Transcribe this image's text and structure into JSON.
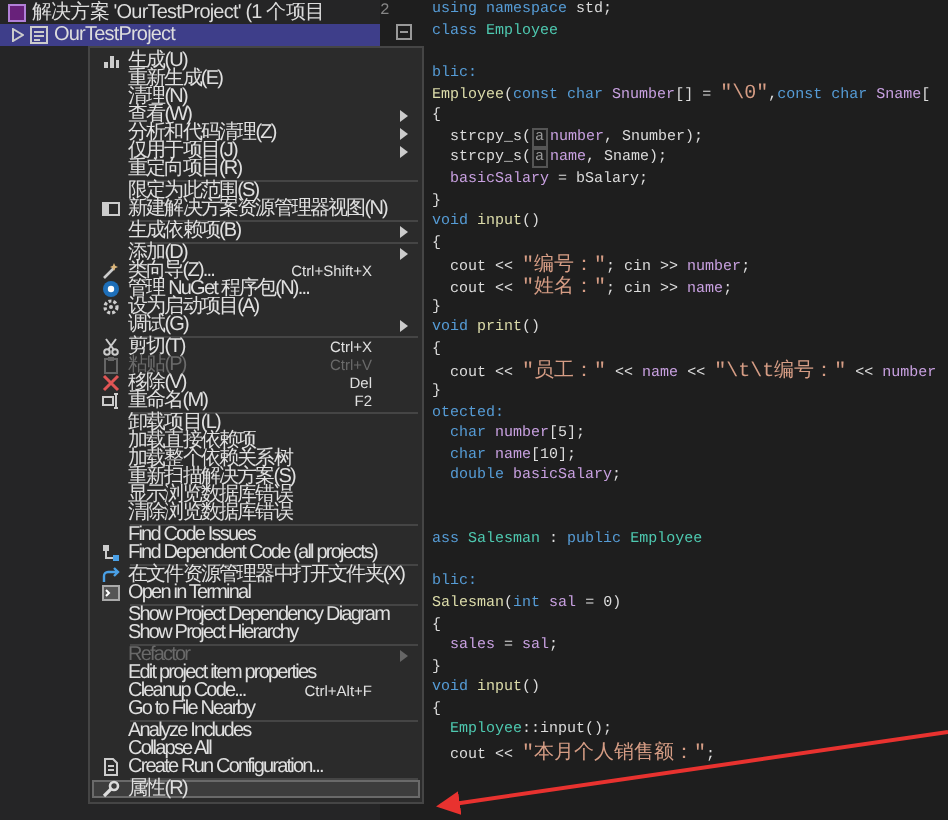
{
  "explorer": {
    "rows": [
      {
        "kind": "solution",
        "label": "解决方案 'OurTestProject' (1 个项目",
        "selected": false
      },
      {
        "kind": "project",
        "label": "OurTestProject",
        "selected": true
      }
    ]
  },
  "editor": {
    "line_numbers": [
      "2"
    ],
    "lines": [
      {
        "kind": "code",
        "tokens": [
          {
            "text": "using namespace ",
            "kind": "kw"
          },
          {
            "text": "std;",
            "kind": "txt"
          }
        ]
      },
      {
        "kind": "code",
        "tokens": [
          {
            "text": "class ",
            "kind": "kw"
          },
          {
            "text": "Employee",
            "kind": "type"
          }
        ]
      },
      {
        "kind": "blank"
      },
      {
        "kind": "code",
        "tokens": [
          {
            "text": "blic:",
            "kind": "kw"
          }
        ]
      },
      {
        "kind": "code",
        "tokens": [
          {
            "text": "Employee",
            "kind": "fn"
          },
          {
            "text": "(",
            "kind": "txt"
          },
          {
            "text": "const char ",
            "kind": "kw"
          },
          {
            "text": "Snumber",
            "kind": "var"
          },
          {
            "text": "[] = ",
            "kind": "txt"
          },
          {
            "text": "\"\\0\"",
            "kind": "str"
          },
          {
            "text": ",",
            "kind": "txt"
          },
          {
            "text": "const char ",
            "kind": "kw"
          },
          {
            "text": "Sname",
            "kind": "var"
          },
          {
            "text": "[",
            "kind": "txt"
          }
        ]
      },
      {
        "kind": "code",
        "tokens": [
          {
            "text": "{",
            "kind": "txt"
          }
        ]
      },
      {
        "kind": "code",
        "tokens": [
          {
            "text": "  strcpy_s(",
            "kind": "txt"
          },
          {
            "text": "a",
            "kind": "hint"
          },
          {
            "text": "number",
            "kind": "var"
          },
          {
            "text": ", Snumber);",
            "kind": "txt"
          }
        ]
      },
      {
        "kind": "code",
        "tokens": [
          {
            "text": "  strcpy_s(",
            "kind": "txt"
          },
          {
            "text": "a",
            "kind": "hint"
          },
          {
            "text": "name",
            "kind": "var"
          },
          {
            "text": ", Sname);",
            "kind": "txt"
          }
        ]
      },
      {
        "kind": "code",
        "tokens": [
          {
            "text": "  basicSalary",
            "kind": "var"
          },
          {
            "text": " = bSalary;",
            "kind": "txt"
          }
        ]
      },
      {
        "kind": "code",
        "tokens": [
          {
            "text": "}",
            "kind": "txt"
          }
        ]
      },
      {
        "kind": "code",
        "tokens": [
          {
            "text": "void ",
            "kind": "kw"
          },
          {
            "text": "input",
            "kind": "fn"
          },
          {
            "text": "()",
            "kind": "txt"
          }
        ]
      },
      {
        "kind": "code",
        "tokens": [
          {
            "text": "{",
            "kind": "txt"
          }
        ]
      },
      {
        "kind": "code",
        "tokens": [
          {
            "text": "  cout << ",
            "kind": "txt"
          },
          {
            "text": "\"编号：\"",
            "kind": "str"
          },
          {
            "text": "; cin >> ",
            "kind": "txt"
          },
          {
            "text": "number",
            "kind": "var"
          },
          {
            "text": ";",
            "kind": "txt"
          }
        ]
      },
      {
        "kind": "code",
        "tokens": [
          {
            "text": "  cout << ",
            "kind": "txt"
          },
          {
            "text": "\"姓名：\"",
            "kind": "str"
          },
          {
            "text": "; cin >> ",
            "kind": "txt"
          },
          {
            "text": "name",
            "kind": "var"
          },
          {
            "text": ";",
            "kind": "txt"
          }
        ]
      },
      {
        "kind": "code",
        "tokens": [
          {
            "text": "}",
            "kind": "txt"
          }
        ]
      },
      {
        "kind": "code",
        "tokens": [
          {
            "text": "void ",
            "kind": "kw"
          },
          {
            "text": "print",
            "kind": "fn"
          },
          {
            "text": "()",
            "kind": "txt"
          }
        ]
      },
      {
        "kind": "code",
        "tokens": [
          {
            "text": "{",
            "kind": "txt"
          }
        ]
      },
      {
        "kind": "code",
        "tokens": [
          {
            "text": "  cout << ",
            "kind": "txt"
          },
          {
            "text": "\"员工：\"",
            "kind": "str"
          },
          {
            "text": " << ",
            "kind": "txt"
          },
          {
            "text": "name",
            "kind": "var"
          },
          {
            "text": " << ",
            "kind": "txt"
          },
          {
            "text": "\"\\t\\t编号：\"",
            "kind": "str"
          },
          {
            "text": " << ",
            "kind": "txt"
          },
          {
            "text": "number",
            "kind": "var"
          }
        ]
      },
      {
        "kind": "code",
        "tokens": [
          {
            "text": "}",
            "kind": "txt"
          }
        ]
      },
      {
        "kind": "code",
        "tokens": [
          {
            "text": "otected:",
            "kind": "kw"
          }
        ]
      },
      {
        "kind": "code",
        "tokens": [
          {
            "text": "  char ",
            "kind": "kw"
          },
          {
            "text": "number",
            "kind": "var"
          },
          {
            "text": "[5];",
            "kind": "txt"
          }
        ]
      },
      {
        "kind": "code",
        "tokens": [
          {
            "text": "  char ",
            "kind": "kw"
          },
          {
            "text": "name",
            "kind": "var"
          },
          {
            "text": "[10];",
            "kind": "txt"
          }
        ]
      },
      {
        "kind": "code",
        "tokens": [
          {
            "text": "  double ",
            "kind": "kw"
          },
          {
            "text": "basicSalary",
            "kind": "var"
          },
          {
            "text": ";",
            "kind": "txt"
          }
        ]
      },
      {
        "kind": "blank"
      },
      {
        "kind": "blank"
      },
      {
        "kind": "code",
        "tokens": [
          {
            "text": "ass ",
            "kind": "kw"
          },
          {
            "text": "Salesman",
            "kind": "type"
          },
          {
            "text": " : ",
            "kind": "txt"
          },
          {
            "text": "public ",
            "kind": "kw"
          },
          {
            "text": "Employee",
            "kind": "type"
          }
        ]
      },
      {
        "kind": "blank"
      },
      {
        "kind": "code",
        "tokens": [
          {
            "text": "blic:",
            "kind": "kw"
          }
        ]
      },
      {
        "kind": "code",
        "tokens": [
          {
            "text": "Salesman",
            "kind": "fn"
          },
          {
            "text": "(",
            "kind": "txt"
          },
          {
            "text": "int ",
            "kind": "kw"
          },
          {
            "text": "sal",
            "kind": "var"
          },
          {
            "text": " = 0)",
            "kind": "txt"
          }
        ]
      },
      {
        "kind": "code",
        "tokens": [
          {
            "text": "{",
            "kind": "txt"
          }
        ]
      },
      {
        "kind": "code",
        "tokens": [
          {
            "text": "  sales",
            "kind": "var"
          },
          {
            "text": " = ",
            "kind": "txt"
          },
          {
            "text": "sal",
            "kind": "var"
          },
          {
            "text": ";",
            "kind": "txt"
          }
        ]
      },
      {
        "kind": "code",
        "tokens": [
          {
            "text": "}",
            "kind": "txt"
          }
        ]
      },
      {
        "kind": "code",
        "tokens": [
          {
            "text": "void ",
            "kind": "kw"
          },
          {
            "text": "input",
            "kind": "fn"
          },
          {
            "text": "()",
            "kind": "txt"
          }
        ]
      },
      {
        "kind": "code",
        "tokens": [
          {
            "text": "{",
            "kind": "txt"
          }
        ]
      },
      {
        "kind": "code",
        "tokens": [
          {
            "text": "  Employee",
            "kind": "type"
          },
          {
            "text": "::input();",
            "kind": "txt"
          }
        ]
      },
      {
        "kind": "code",
        "tokens": [
          {
            "text": "  cout << ",
            "kind": "txt"
          },
          {
            "text": "\"本月个人销售额：\"",
            "kind": "str"
          },
          {
            "text": ";",
            "kind": "txt"
          }
        ]
      }
    ]
  },
  "context_menu": {
    "groups": [
      [
        {
          "label": "生成(U)",
          "sub": false,
          "disabled": false,
          "selected": false
        },
        {
          "label": "重新生成(E)",
          "sub": false,
          "disabled": false,
          "selected": false
        },
        {
          "label": "清理(N)",
          "sub": false,
          "disabled": false,
          "selected": false
        },
        {
          "label": "查看(W)",
          "sub": true,
          "disabled": false,
          "selected": false
        },
        {
          "label": "分析和代码清理(Z)",
          "sub": true,
          "disabled": false,
          "selected": false
        },
        {
          "label": "仅用于项目(J)",
          "sub": true,
          "disabled": false,
          "selected": false
        },
        {
          "label": "重定向项目(R)",
          "sub": false,
          "disabled": false,
          "selected": false
        }
      ],
      [
        {
          "label": "限定为此范围(S)",
          "sub": false,
          "disabled": false,
          "selected": false
        },
        {
          "label": "新建解决方案资源管理器视图(N)",
          "sub": false,
          "disabled": false,
          "selected": false
        }
      ],
      [
        {
          "label": "生成依赖项(B)",
          "sub": true,
          "disabled": false,
          "selected": false
        }
      ],
      [
        {
          "label": "添加(D)",
          "sub": true,
          "disabled": false,
          "selected": false
        },
        {
          "label": "类向导(Z)...",
          "shortcut": "Ctrl+Shift+X",
          "sub": false,
          "disabled": false,
          "selected": false
        },
        {
          "label": "管理 NuGet 程序包(N)...",
          "sub": false,
          "disabled": false,
          "selected": false
        },
        {
          "label": "设为启动项目(A)",
          "sub": false,
          "disabled": false,
          "selected": false
        },
        {
          "label": "调试(G)",
          "sub": true,
          "disabled": false,
          "selected": false
        }
      ],
      [
        {
          "label": "剪切(T)",
          "shortcut": "Ctrl+X",
          "sub": false,
          "disabled": false,
          "selected": false
        },
        {
          "label": "粘贴(P)",
          "shortcut": "Ctrl+V",
          "sub": false,
          "disabled": true,
          "selected": false
        },
        {
          "label": "移除(V)",
          "shortcut": "Del",
          "sub": false,
          "disabled": false,
          "selected": false
        },
        {
          "label": "重命名(M)",
          "shortcut": "F2",
          "sub": false,
          "disabled": false,
          "selected": false
        }
      ],
      [
        {
          "label": "卸载项目(L)",
          "sub": false,
          "disabled": false,
          "selected": false
        },
        {
          "label": "加载直接依赖项",
          "sub": false,
          "disabled": false,
          "selected": false
        },
        {
          "label": "加载整个依赖关系树",
          "sub": false,
          "disabled": false,
          "selected": false
        },
        {
          "label": "重新扫描解决方案(S)",
          "sub": false,
          "disabled": false,
          "selected": false
        },
        {
          "label": "显示浏览数据库错误",
          "sub": false,
          "disabled": false,
          "selected": false
        },
        {
          "label": "清除浏览数据库错误",
          "sub": false,
          "disabled": false,
          "selected": false
        }
      ],
      [
        {
          "label": "Find Code Issues",
          "sub": false,
          "disabled": false,
          "selected": false
        },
        {
          "label": "Find Dependent Code (all projects)",
          "sub": false,
          "disabled": false,
          "selected": false
        }
      ],
      [
        {
          "label": "在文件资源管理器中打开文件夹(X)",
          "sub": false,
          "disabled": false,
          "selected": false
        },
        {
          "label": "Open in Terminal",
          "sub": false,
          "disabled": false,
          "selected": false
        }
      ],
      [
        {
          "label": "Show Project Dependency Diagram",
          "sub": false,
          "disabled": false,
          "selected": false
        },
        {
          "label": "Show Project Hierarchy",
          "sub": false,
          "disabled": false,
          "selected": false
        }
      ],
      [
        {
          "label": "Refactor",
          "sub": true,
          "disabled": true,
          "selected": false
        },
        {
          "label": "Edit project item properties",
          "sub": false,
          "disabled": false,
          "selected": false
        },
        {
          "label": "Cleanup Code...",
          "shortcut": "Ctrl+Alt+F",
          "sub": false,
          "disabled": false,
          "selected": false
        },
        {
          "label": "Go to File Nearby",
          "sub": false,
          "disabled": false,
          "selected": false
        }
      ],
      [
        {
          "label": "Analyze Includes",
          "sub": false,
          "disabled": false,
          "selected": false
        },
        {
          "label": "Collapse All",
          "sub": false,
          "disabled": false,
          "selected": false
        },
        {
          "label": "Create Run Configuration...",
          "sub": false,
          "disabled": false,
          "selected": false
        }
      ],
      [
        {
          "label": "属性(R)",
          "sub": false,
          "disabled": false,
          "selected": true
        }
      ]
    ]
  }
}
